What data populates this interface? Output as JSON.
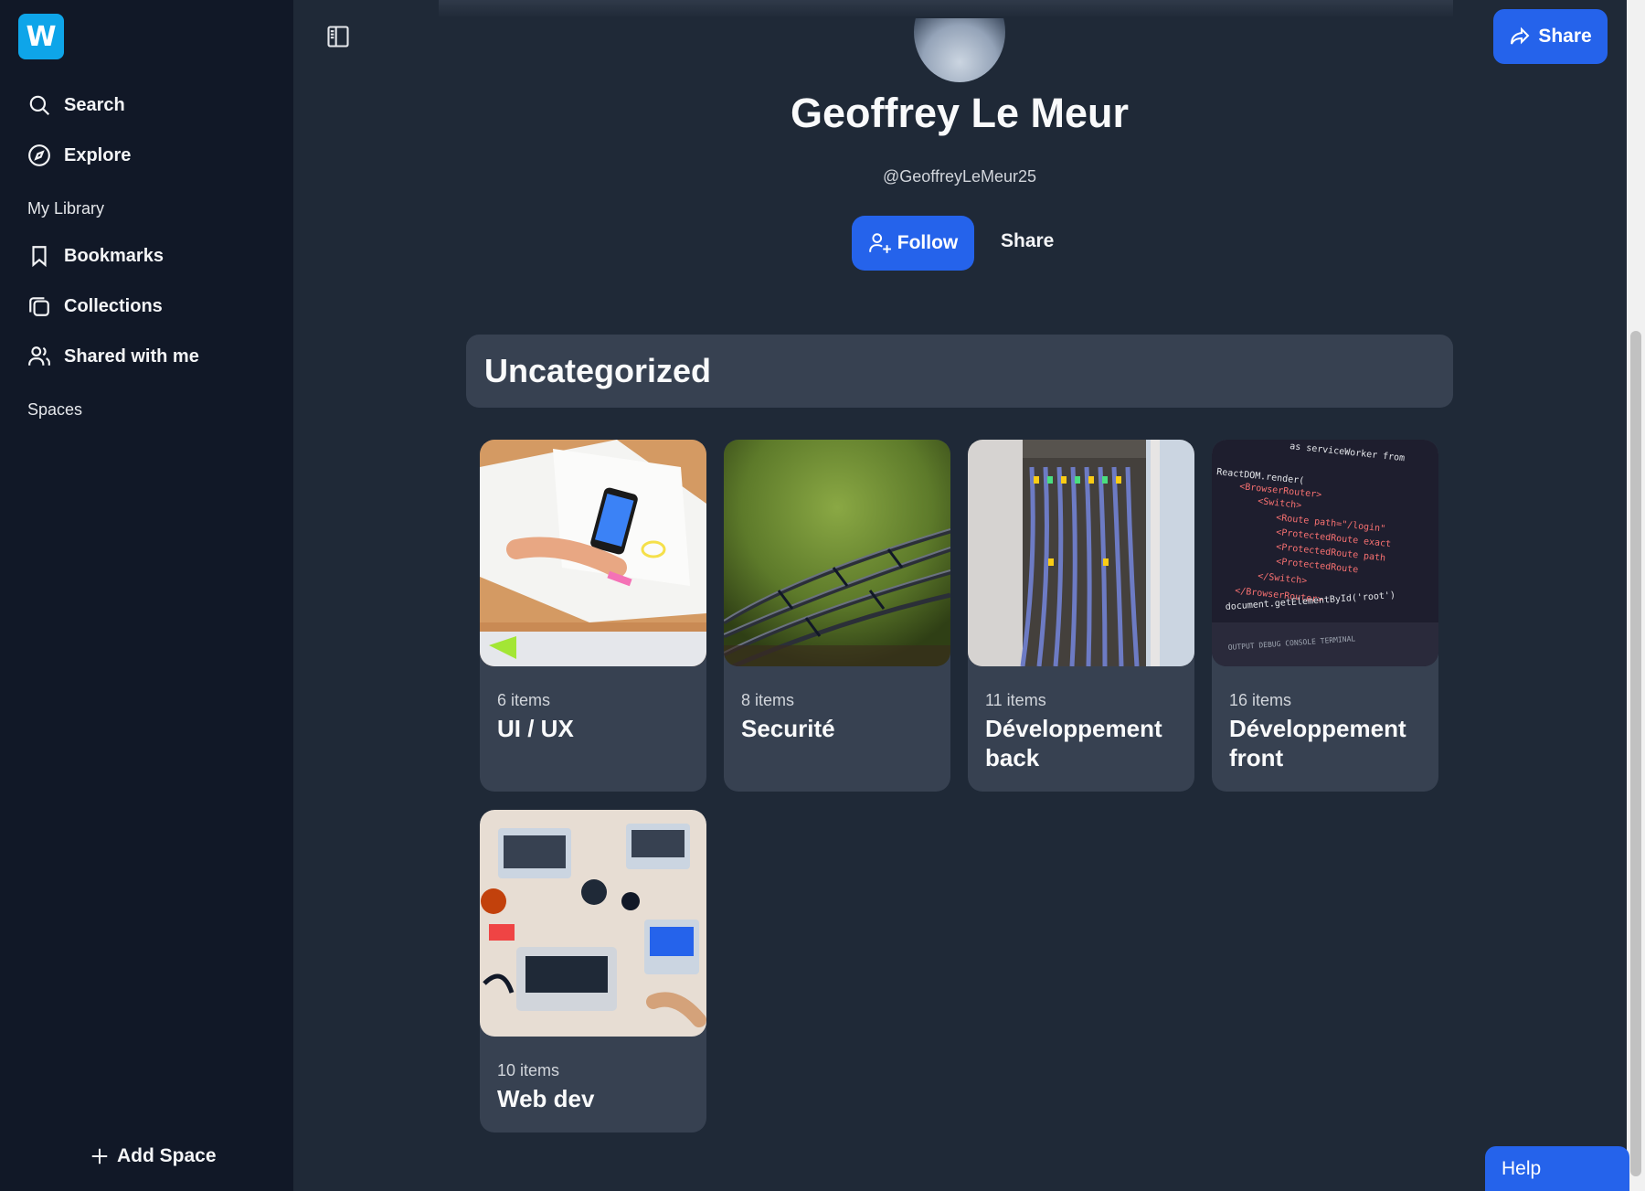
{
  "sidebar": {
    "logo_letter": "W",
    "nav": [
      {
        "label": "Search",
        "icon": "search-icon"
      },
      {
        "label": "Explore",
        "icon": "compass-icon"
      }
    ],
    "my_library_label": "My Library",
    "library": [
      {
        "label": "Bookmarks",
        "icon": "bookmark-icon"
      },
      {
        "label": "Collections",
        "icon": "collections-icon"
      },
      {
        "label": "Shared with me",
        "icon": "users-icon"
      }
    ],
    "spaces_label": "Spaces",
    "add_space_label": "Add Space"
  },
  "topbar": {
    "share_label": "Share"
  },
  "profile": {
    "name": "Geoffrey Le Meur",
    "handle": "@GeoffreyLeMeur25",
    "follow_label": "Follow",
    "share_label": "Share"
  },
  "category": {
    "title": "Uncategorized"
  },
  "collections": [
    {
      "count": "6 items",
      "title": "UI / UX"
    },
    {
      "count": "8 items",
      "title": "Securité"
    },
    {
      "count": "11 items",
      "title": "Développement back"
    },
    {
      "count": "16 items",
      "title": "Développement front"
    },
    {
      "count": "10 items",
      "title": "Web dev"
    }
  ],
  "help_label": "Help",
  "colors": {
    "accent": "#2563eb",
    "logo": "#0ea5e9",
    "sidebar_bg": "#111827",
    "main_bg": "#1f2937",
    "card_bg": "#374151"
  }
}
